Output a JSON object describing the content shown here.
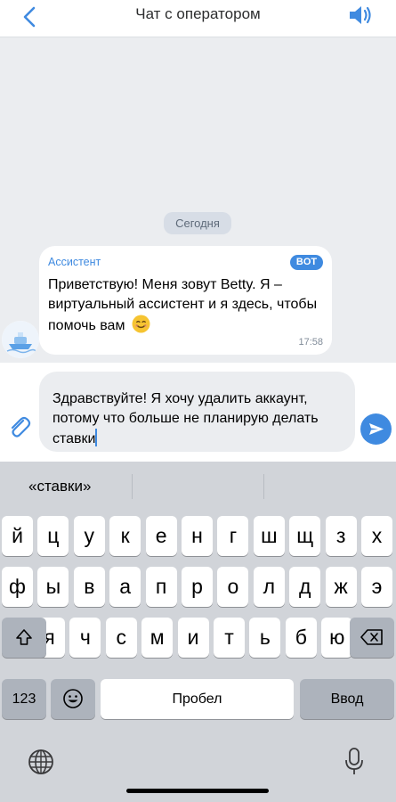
{
  "header": {
    "title": "Чат с оператором",
    "back_icon": "chevron-left-icon",
    "speaker_icon": "speaker-icon"
  },
  "chat": {
    "date_label": "Сегодня",
    "message": {
      "sender": "Ассистент",
      "badge": "BOT",
      "text": "Приветствую! Меня зовут Betty. Я – виртуальный ассистент и я здесь, чтобы помочь вам",
      "emoji": "smiling-face-emoji",
      "time": "17:58"
    }
  },
  "composer": {
    "value": "Здравствуйте! Я хочу удалить аккаунт, потому что больше не планирую делать ставки",
    "attach_icon": "paperclip-icon",
    "send_icon": "send-icon"
  },
  "keyboard": {
    "suggestion": "«ставки»",
    "row1": [
      "й",
      "ц",
      "у",
      "к",
      "е",
      "н",
      "г",
      "ш",
      "щ",
      "з",
      "х"
    ],
    "row2": [
      "ф",
      "ы",
      "в",
      "а",
      "п",
      "р",
      "о",
      "л",
      "д",
      "ж",
      "э"
    ],
    "row3": [
      "я",
      "ч",
      "с",
      "м",
      "и",
      "т",
      "ь",
      "б",
      "ю"
    ],
    "num_label": "123",
    "space_label": "Пробел",
    "return_label": "Ввод"
  },
  "colors": {
    "accent": "#3f8ae0",
    "background": "#ebedf0",
    "keyboard_bg": "#d1d4d9"
  }
}
